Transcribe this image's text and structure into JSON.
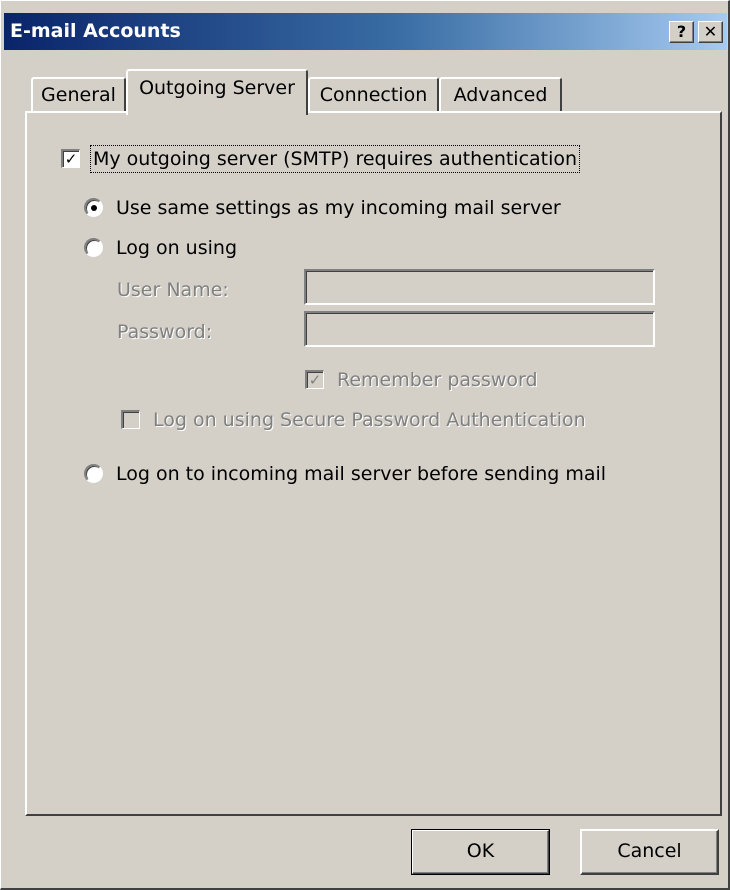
{
  "window": {
    "title": "E-mail Accounts",
    "help_glyph": "?",
    "close_glyph": "✕"
  },
  "tabs": [
    {
      "label": "General",
      "active": false
    },
    {
      "label": "Outgoing Server",
      "active": true
    },
    {
      "label": "Connection",
      "active": false
    },
    {
      "label": "Advanced",
      "active": false
    }
  ],
  "outgoing": {
    "smtp_auth": {
      "label": "My outgoing server (SMTP) requires authentication",
      "checked": true
    },
    "use_same": {
      "label": "Use same settings as my incoming mail server",
      "selected": true
    },
    "log_on_using": {
      "label": "Log on using",
      "selected": false
    },
    "user_name": {
      "label": "User Name:",
      "value": ""
    },
    "password": {
      "label": "Password:",
      "value": ""
    },
    "remember_password": {
      "label": "Remember password",
      "checked": true,
      "enabled": false
    },
    "spa": {
      "label": "Log on using Secure Password Authentication",
      "checked": false,
      "enabled": false
    },
    "log_on_incoming": {
      "label": "Log on to incoming mail server before sending mail",
      "selected": false
    }
  },
  "buttons": {
    "ok": "OK",
    "cancel": "Cancel"
  },
  "glyphs": {
    "check": "✓"
  }
}
